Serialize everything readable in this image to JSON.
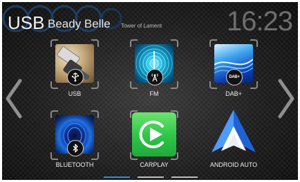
{
  "header": {
    "source": "USB",
    "track_title": "Beady Belle",
    "artist": "Tower of Lament",
    "clock": "16:23"
  },
  "nav": {
    "left_icon": "chevron-left-icon",
    "right_icon": "chevron-right-icon"
  },
  "tiles": [
    {
      "label": "USB",
      "icon": "usb-icon"
    },
    {
      "label": "FM",
      "icon": "radio-tower-icon"
    },
    {
      "label": "DAB+",
      "icon": "dab-icon"
    },
    {
      "label": "BLUETOOTH",
      "icon": "bluetooth-icon"
    },
    {
      "label": "CARPLAY",
      "icon": "carplay-icon"
    },
    {
      "label": "ANDROID AUTO",
      "icon": "android-auto-icon"
    }
  ],
  "pager": {
    "pages": 3,
    "current": 1,
    "active_color": "#2f8fd8",
    "inactive_color": "#bfbfbf"
  },
  "colors": {
    "carplay_green": "#2fc84a",
    "android_blue": "#3b82f6",
    "fm_cyan": "#1fb8e0",
    "bluetooth_blue": "#1d6fe0"
  }
}
